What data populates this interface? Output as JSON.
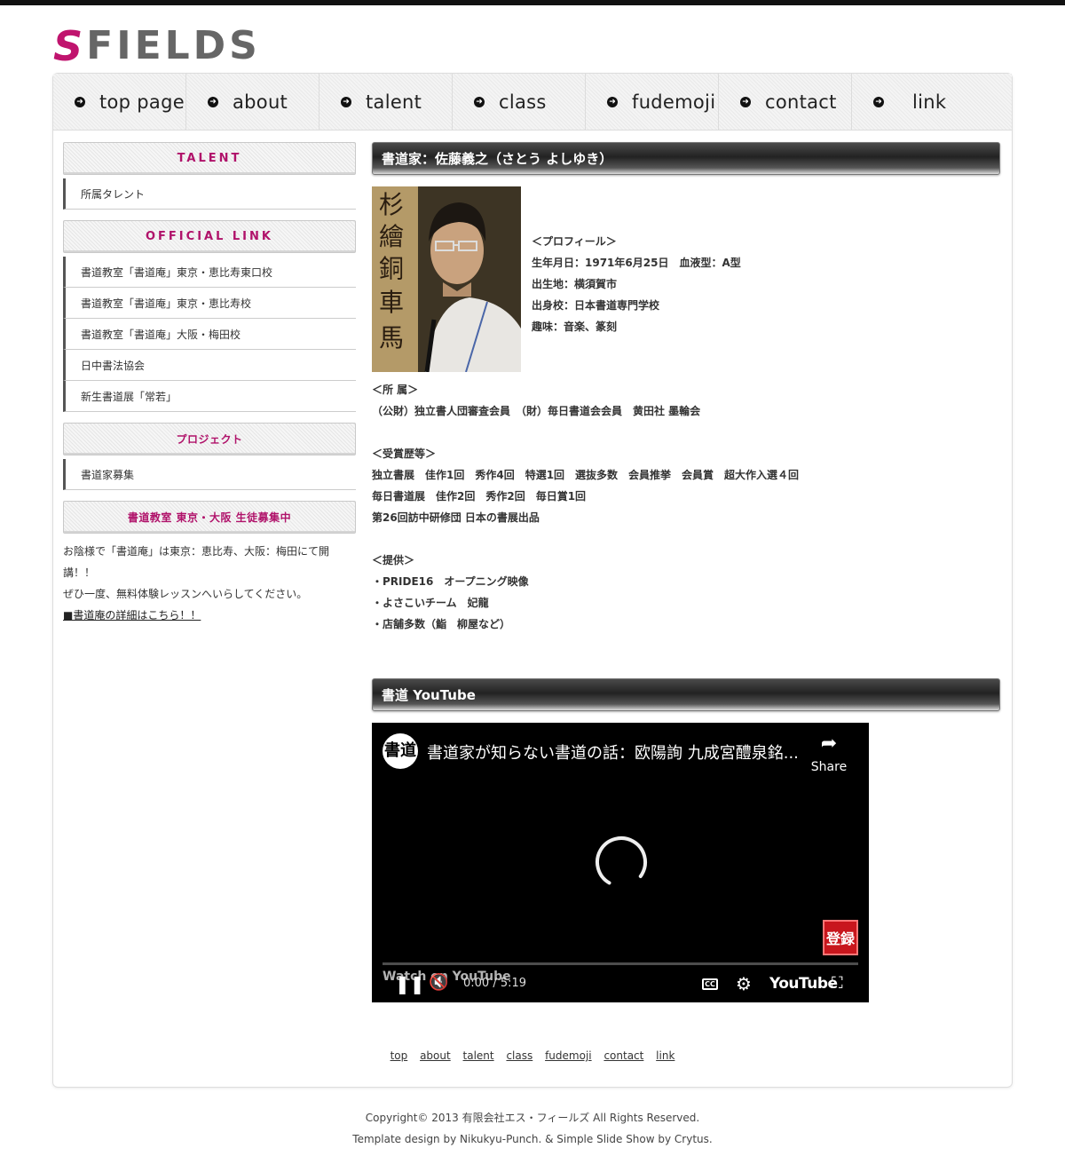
{
  "brand": {
    "logo_s": "S",
    "logo_text": "FIELDS"
  },
  "nav": [
    {
      "label": "top page"
    },
    {
      "label": "about"
    },
    {
      "label": "talent"
    },
    {
      "label": "class"
    },
    {
      "label": "fudemoji"
    },
    {
      "label": "contact"
    },
    {
      "label": "link"
    }
  ],
  "sidebar": {
    "talent_heading": "TALENT",
    "talent_items": [
      "所属タレント"
    ],
    "official_heading": "OFFICIAL LINK",
    "official_items": [
      "書道教室「書道庵」東京・恵比寿東口校",
      "書道教室「書道庵」東京・恵比寿校",
      "書道教室「書道庵」大阪・梅田校",
      "日中書法協会",
      "新生書道展「常若」"
    ],
    "project_heading": "プロジェクト",
    "project_items": [
      "書道家募集"
    ],
    "school_heading": "書道教室 東京・大阪 生徒募集中",
    "school_text_1": "お陰様で「書道庵」は東京：恵比寿、大阪：梅田にて開",
    "school_text_2": "講！！",
    "school_text_3": "ぜひ一度、無料体験レッスンへいらしてください。",
    "school_link": "■書道庵の詳細はこちら！！"
  },
  "main": {
    "heading": "書道家：佐藤義之（さとう よしゆき）",
    "profile": {
      "title": "＜プロフィール＞",
      "birth": "生年月日：1971年6月25日　血液型：A型",
      "birthplace": "出生地：横須賀市",
      "school": "出身校：日本書道専門学校",
      "hobby": "趣味：音楽、篆刻"
    },
    "affiliation_title": "＜所 属＞",
    "affiliation": "（公財）独立書人団審査会員　（財）毎日書道会会員　黄田社 墨輪会",
    "awards_title": "＜受賞歴等＞",
    "awards": [
      "独立書展　佳作1回　秀作4回　特選1回　選抜多数　会員推挙　会員賞　超大作入選４回",
      "毎日書道展　佳作2回　秀作2回　毎日賞1回",
      "第26回訪中研修団 日本の書展出品"
    ],
    "provided_title": "＜提供＞",
    "provided": [
      "・PRIDE16　オープニング映像",
      "・よさこいチーム　妃龍",
      "・店舗多数（鮨　柳屋など）"
    ],
    "youtube_heading": "書道 YouTube"
  },
  "video": {
    "avatar_text": "書道",
    "title": "書道家が知らない書道の話：欧陽詢 九成宮醴泉銘...",
    "share_label": "Share",
    "badge_text": "登録",
    "watch_on": "Watch on YouTube",
    "time": "0:00 / 5:19",
    "cc": "CC",
    "youtube_logo": "YouTube",
    "progress": 0,
    "icons": {
      "play": "pause-icon",
      "mute": "mute-icon",
      "settings": "gear-icon",
      "fullscreen": "fullscreen-icon",
      "share": "share-icon"
    }
  },
  "footer_nav": [
    "top",
    "about",
    "talent",
    "class",
    "fudemoji",
    "contact",
    "link"
  ],
  "copyright": {
    "line1": "Copyright© 2013 有限会社エス・フィールズ All Rights Reserved.",
    "line2": "Template design by Nikukyu-Punch. & Simple Slide Show by Crytus."
  },
  "colors": {
    "accent": "#b0126a",
    "logo_s": "#c0146e",
    "logo_text": "#666666",
    "header_dark": "#222222"
  }
}
